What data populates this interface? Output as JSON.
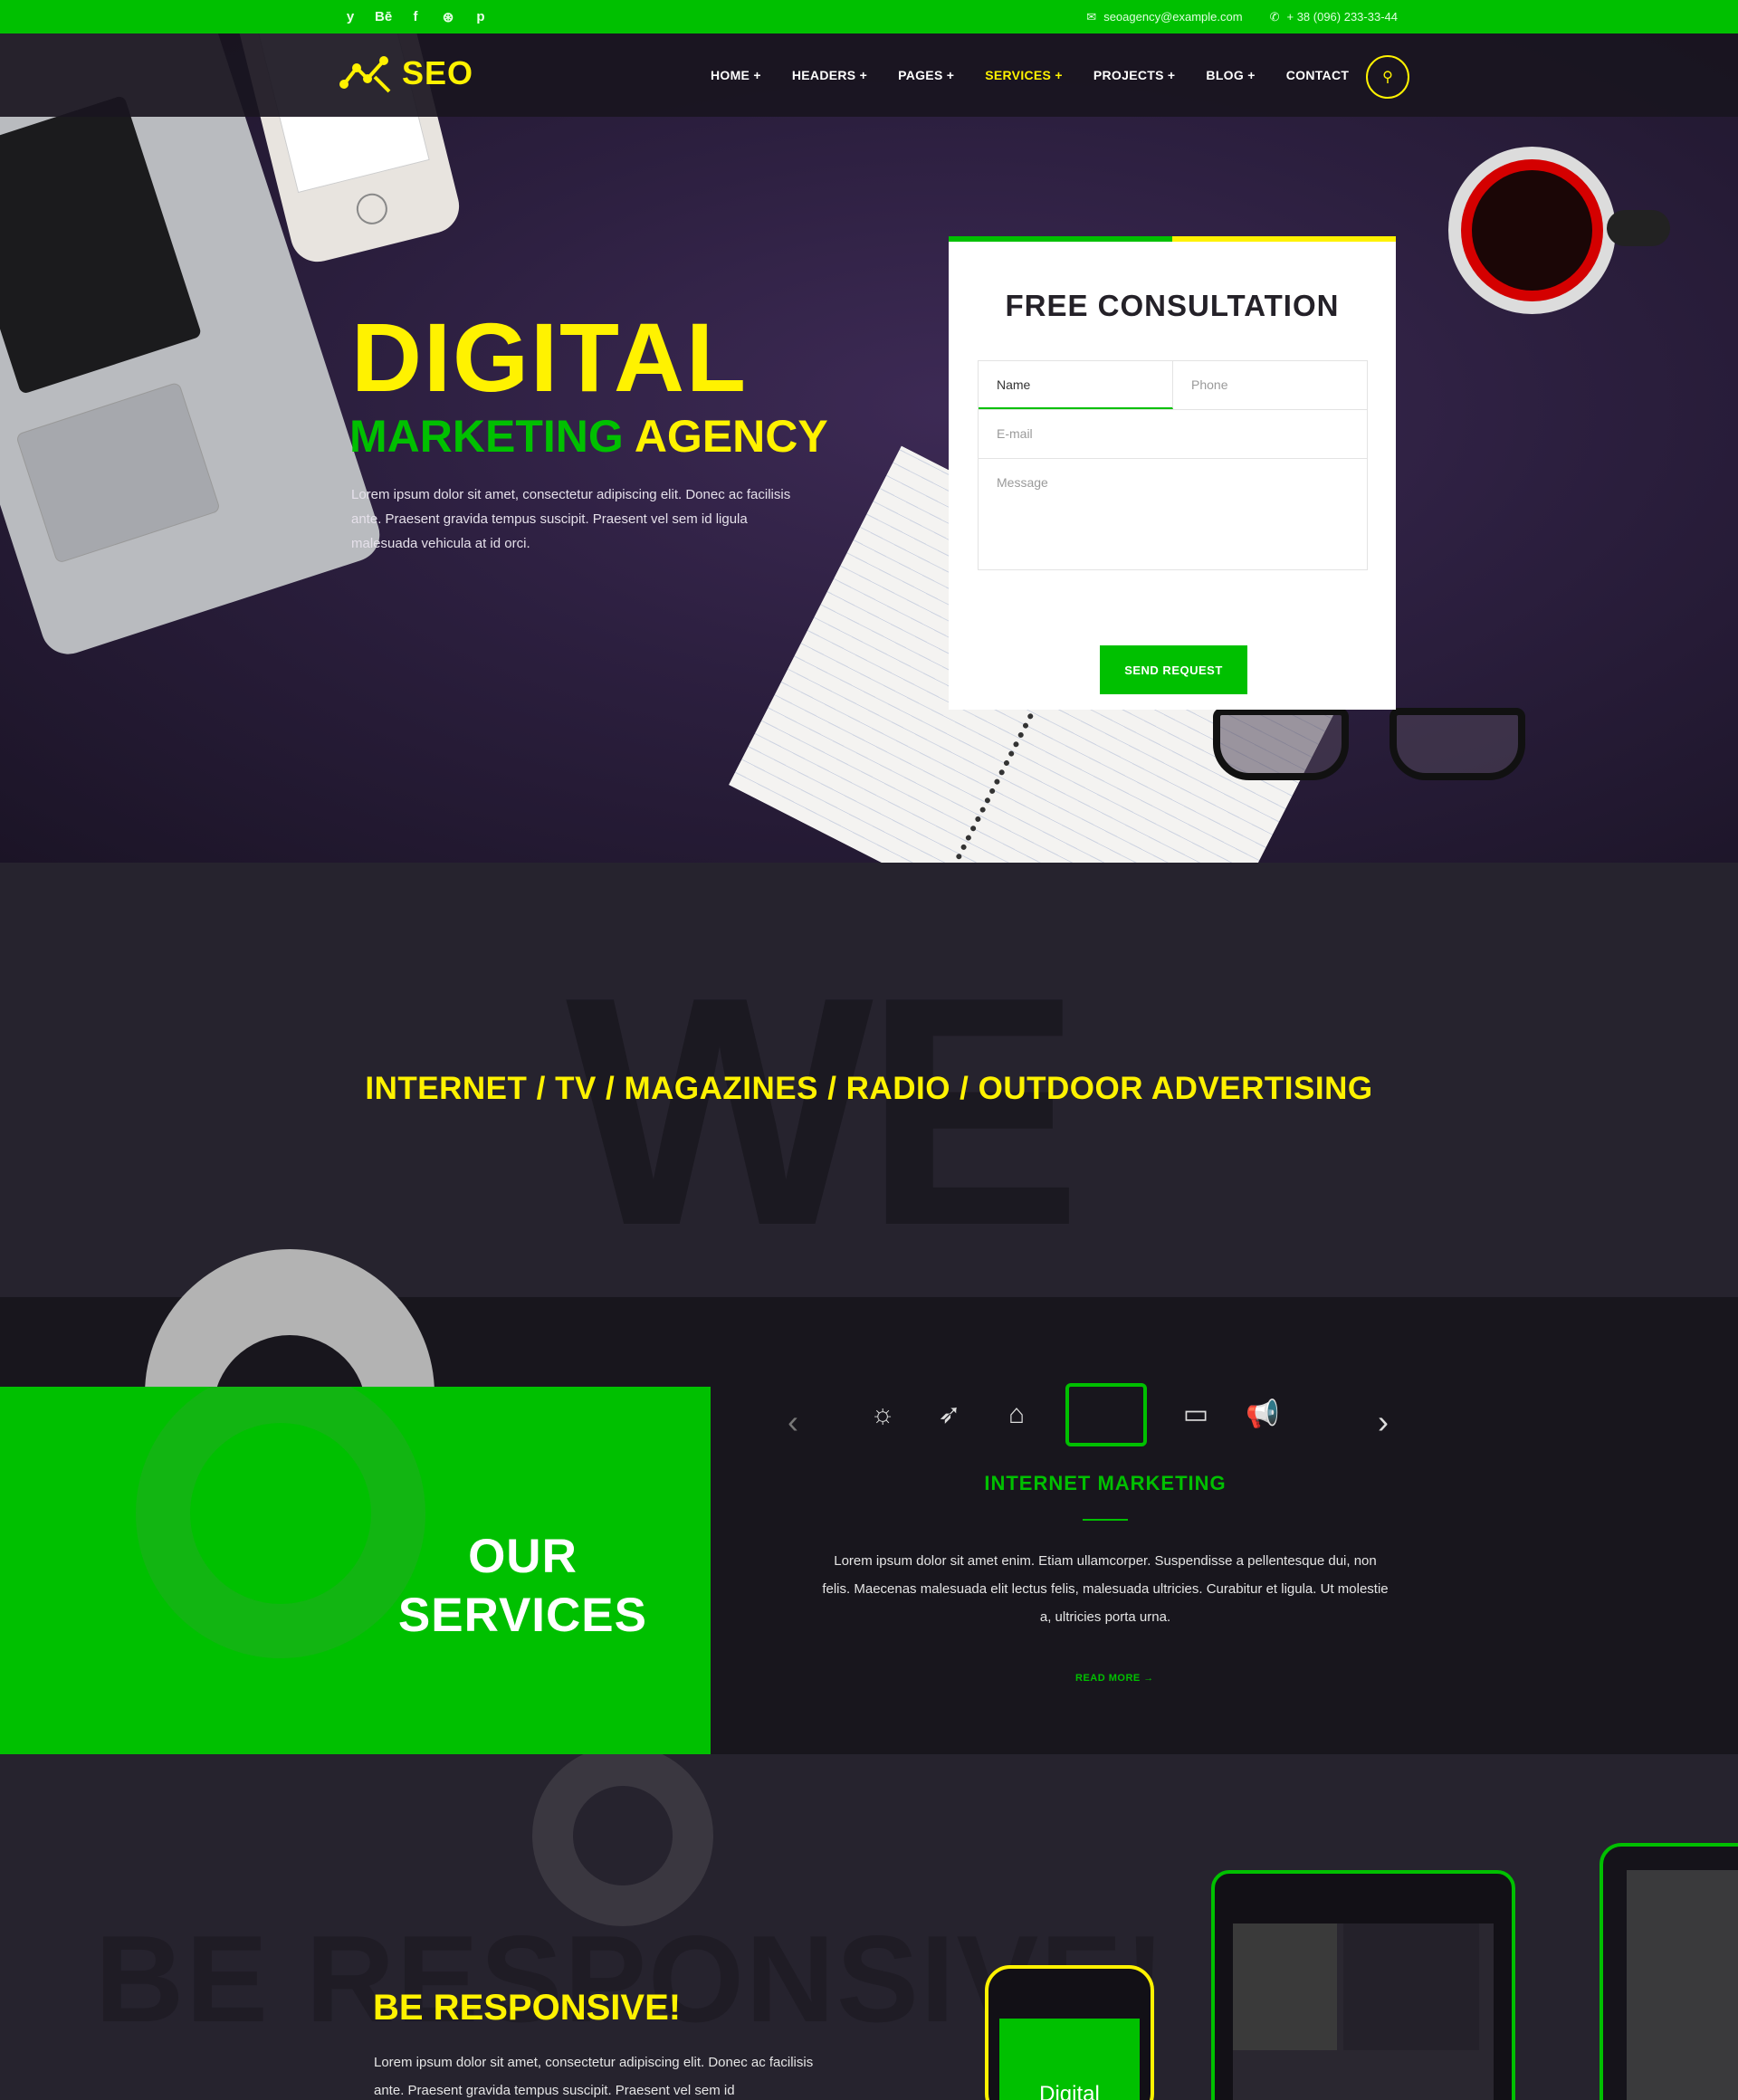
{
  "topbar": {
    "social": [
      "y",
      "Bē",
      "f",
      "⊛",
      "p"
    ],
    "email": "seoagency@example.com",
    "phone": "+ 38 (096) 233-33-44"
  },
  "header": {
    "logo_text": "SEO",
    "nav": [
      "HOME +",
      "HEADERS +",
      "PAGES +",
      "SERVICES +",
      "PROJECTS +",
      "BLOG +",
      "CONTACT"
    ],
    "active_nav": "SERVICES +"
  },
  "hero": {
    "title_line1": "DIGITAL",
    "title_line2_green": "MARKETING",
    "title_line2_yellow": "AGENCY",
    "text": "Lorem ipsum dolor sit amet, consectetur adipiscing elit. Donec ac facilisis ante. Praesent gravida tempus suscipit. Praesent vel sem id ligula malesuada vehicula at id orci."
  },
  "consultation": {
    "title": "FREE CONSULTATION",
    "name_placeholder": "Name",
    "phone_placeholder": "Phone",
    "email_placeholder": "E-mail",
    "message_placeholder": "Message",
    "send_label": "SEND REQUEST"
  },
  "we": {
    "background_word": "WE",
    "tagline": "INTERNET / TV / MAGAZINES / RADIO / OUTDOOR ADVERTISING"
  },
  "services": {
    "heading_line1": "OUR",
    "heading_line2": "SERVICES",
    "icons": [
      "sun-icon",
      "rocket-icon",
      "store-icon",
      "devices-icon",
      "video-icon",
      "megaphone-icon"
    ],
    "active_title": "INTERNET MARKETING",
    "text": "Lorem ipsum dolor sit amet enim. Etiam ullamcorper. Suspendisse a pellentesque dui, non felis. Maecenas malesuada elit lectus felis, malesuada ultricies. Curabitur et ligula. Ut molestie a, ultricies porta urna.",
    "read_more": "READ MORE"
  },
  "responsive": {
    "background_word": "BE RESPONSIVE!",
    "title": "BE RESPONSIVE!",
    "text": "Lorem ipsum dolor sit amet, consectetur adipiscing elit. Donec ac facilisis ante. Praesent gravida tempus suscipit. Praesent vel sem id",
    "phone_screen_text": "Digital"
  },
  "colors": {
    "green": "#00c000",
    "yellow": "#fff200",
    "dark": "#18161d"
  }
}
